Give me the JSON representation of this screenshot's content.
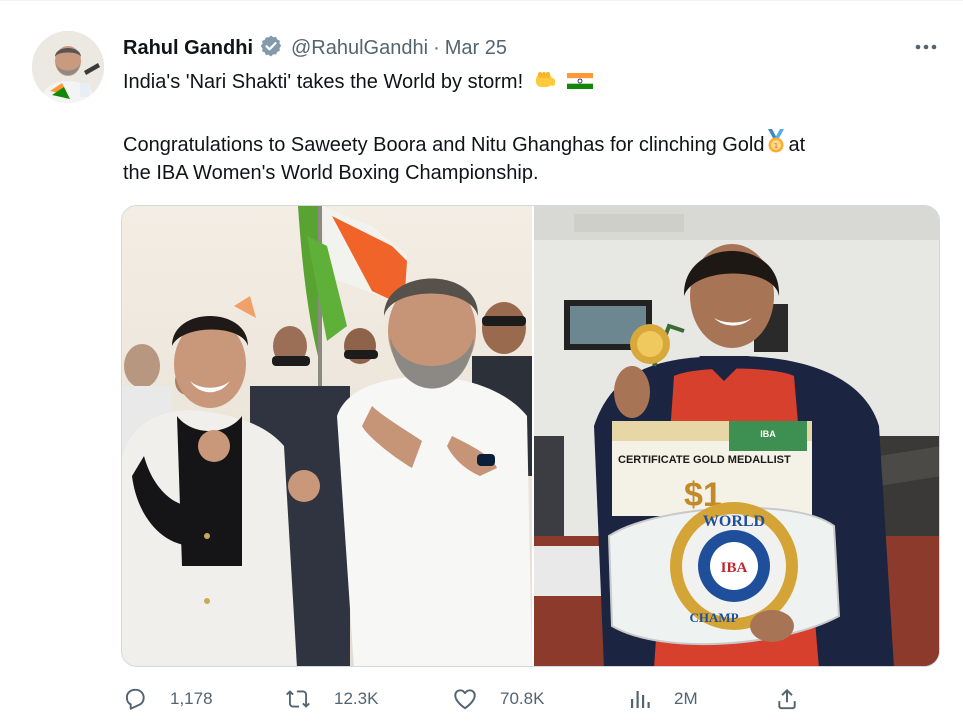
{
  "tweet": {
    "author_name": "Rahul Gandhi",
    "handle": "@RahulGandhi",
    "separator": "·",
    "date": "Mar 25",
    "line1": "India's 'Nari Shakti' takes the World by storm!",
    "line2_before": "Congratulations to Saweety Boora and Nitu Ghanghas for clinching Gold",
    "line2_after": "at",
    "line3": "the IBA Women's World Boxing Championship.",
    "emojis": [
      "fist-emoji",
      "india-flag-emoji",
      "gold-medal-emoji"
    ]
  },
  "media": {
    "right_photo_sign": "CERTIFICATE GOLD MEDALLIST",
    "right_photo_belt_top": "WORLD",
    "right_photo_belt_center": "IBA",
    "right_photo_belt_bottom": "CHAMP",
    "right_photo_banner": "IBA"
  },
  "actions": {
    "replies": "1,178",
    "retweets": "12.3K",
    "likes": "70.8K",
    "views": "2M"
  },
  "colors": {
    "text": "#0f1419",
    "secondary": "#536471",
    "verified": "#829aab",
    "border": "#cfd9de"
  },
  "icons": [
    "verified-badge-icon",
    "more-icon",
    "reply-icon",
    "retweet-icon",
    "like-icon",
    "views-icon",
    "share-icon"
  ]
}
